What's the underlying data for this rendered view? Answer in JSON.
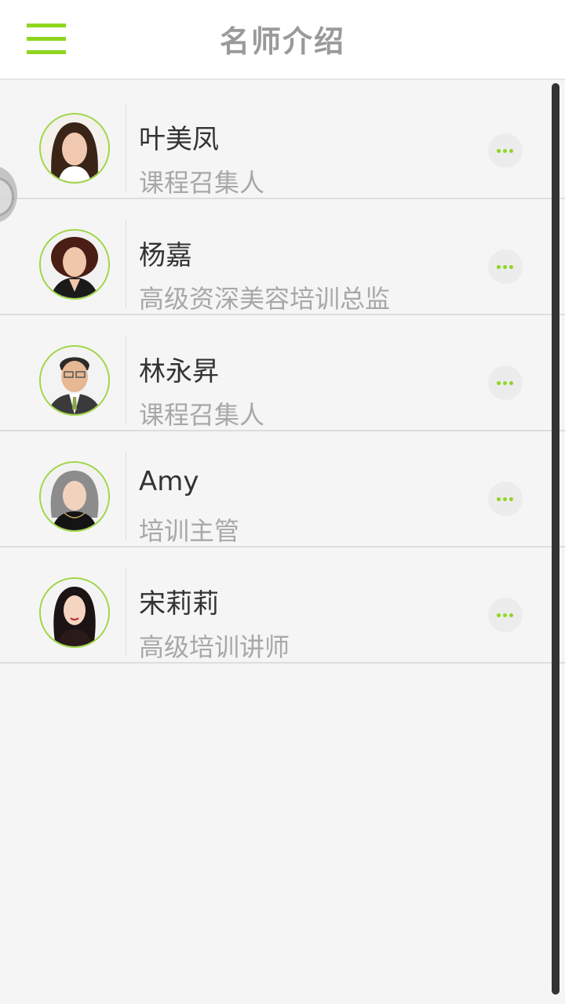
{
  "header": {
    "title": "名师介绍",
    "menu_icon": "hamburger-menu-icon",
    "accent_color": "#8fd61f"
  },
  "teachers": [
    {
      "name": "叶美凤",
      "role": "课程召集人"
    },
    {
      "name": "杨嘉",
      "role": "高级资深美容培训总监"
    },
    {
      "name": "林永昇",
      "role": "课程召集人"
    },
    {
      "name": "Amy",
      "role": "培训主管"
    },
    {
      "name": "宋莉莉",
      "role": "高级培训讲师"
    }
  ],
  "more_icon": "more-dots-icon"
}
